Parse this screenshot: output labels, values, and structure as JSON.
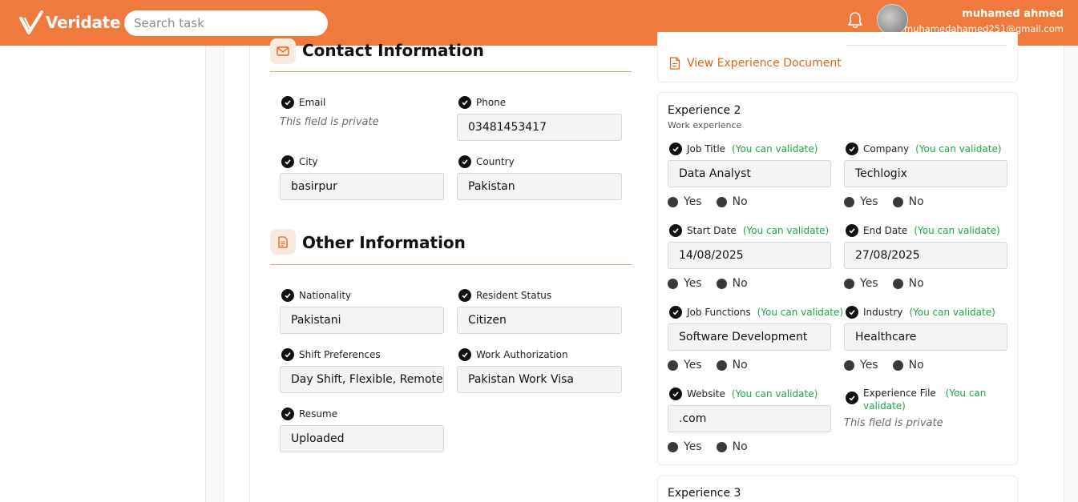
{
  "app": {
    "brand": "Veridate"
  },
  "header": {
    "search_placeholder": "Search task",
    "user_name": "muhamed ahmed",
    "user_email": "muhamedahamed251@gmail.com"
  },
  "contact": {
    "title": "Contact Information",
    "email": {
      "label": "Email",
      "private": "This field is private"
    },
    "phone": {
      "label": "Phone",
      "value": "03481453417"
    },
    "city": {
      "label": "City",
      "value": "basirpur"
    },
    "country": {
      "label": "Country",
      "value": "Pakistan"
    }
  },
  "other": {
    "title": "Other Information",
    "nationality": {
      "label": "Nationality",
      "value": "Pakistani"
    },
    "resident_status": {
      "label": "Resident Status",
      "value": "Citizen"
    },
    "shift": {
      "label": "Shift Preferences",
      "value": "Day Shift, Flexible, Remote"
    },
    "work_auth": {
      "label": "Work Authorization",
      "value": "Pakistan Work Visa"
    },
    "resume": {
      "label": "Resume",
      "value": "Uploaded"
    }
  },
  "exp1": {
    "doc_link": "View Experience Document"
  },
  "exp2": {
    "title": "Experience 2",
    "subtitle": "Work experience",
    "validate_note": "(You can validate)",
    "validate_line1": "(You can",
    "validate_line2": "validate)",
    "yes": "Yes",
    "no": "No",
    "job_title": {
      "label": "Job Title",
      "value": "Data Analyst"
    },
    "company": {
      "label": "Company",
      "value": "Techlogix"
    },
    "start_date": {
      "label": "Start Date",
      "value": "14/08/2025"
    },
    "end_date": {
      "label": "End Date",
      "value": "27/08/2025"
    },
    "job_functions": {
      "label": "Job Functions",
      "value": "Software Development"
    },
    "industry": {
      "label": "Industry",
      "value": "Healthcare"
    },
    "website": {
      "label": "Website",
      "value": ".com"
    },
    "experience_file": {
      "label": "Experience File",
      "private": "This field is private"
    }
  },
  "exp3": {
    "title": "Experience 3"
  },
  "colors": {
    "brand": "#f07a3e",
    "validate": "#1fa34a",
    "link": "#e0651f"
  },
  "icons": [
    "veridate-logo",
    "bell-icon",
    "avatar",
    "mail-icon",
    "document-icon",
    "check-icon",
    "file-icon"
  ]
}
